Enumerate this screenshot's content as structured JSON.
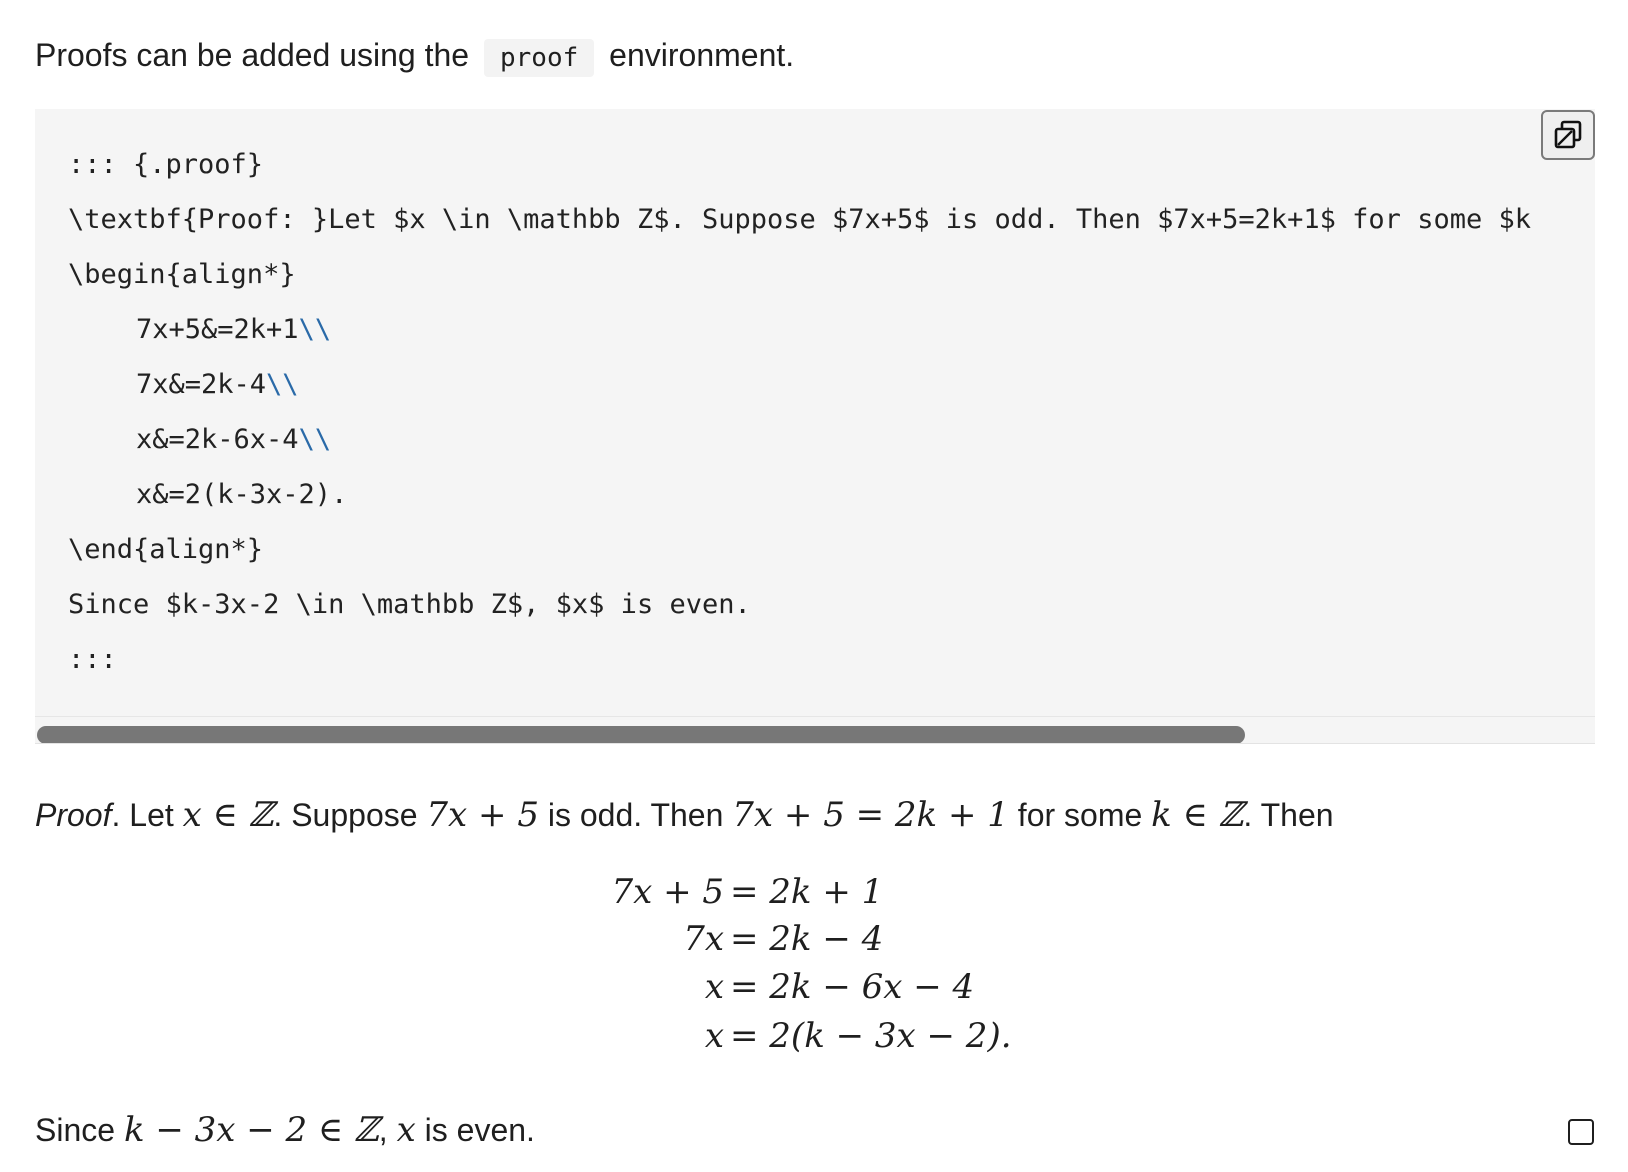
{
  "intro": {
    "before": "Proofs can be added using the",
    "code": "proof",
    "after": "environment."
  },
  "code_block": {
    "lines": [
      "::: {.proof}",
      "\\textbf{Proof: }Let $x \\in \\mathbb Z$. Suppose $7x+5$ is odd. Then $7x+5=2k+1$ for some $k",
      "\\begin{align*}",
      "7x+5&=2k+1",
      "7x&=2k-4",
      "x&=2k-6x-4",
      "x&=2(k-3x-2).",
      "\\end{align*}",
      "Since $k-3x-2 \\in \\mathbb Z$, $x$ is even.",
      ":::"
    ],
    "line_break": "\\\\",
    "copy_icon": "copy-icon"
  },
  "rendered": {
    "proof_label": "Proof",
    "p1": ". Let ",
    "m1": "x ∈ ℤ",
    "p2": ". Suppose ",
    "m2": "7x + 5",
    "p3": " is odd. Then ",
    "m3": "7x + 5 = 2k + 1",
    "p4": " for some ",
    "m4": "k ∈ ℤ",
    "p5": ". Then",
    "align": [
      {
        "lhs": "7x + 5",
        "rhs": "= 2k + 1"
      },
      {
        "lhs": "7x",
        "rhs": "= 2k − 4"
      },
      {
        "lhs": "x",
        "rhs": "= 2k − 6x − 4"
      },
      {
        "lhs": "x",
        "rhs": "= 2(k − 3x − 2)."
      }
    ],
    "since_before": "Since ",
    "since_math": "k − 3x − 2 ∈ ℤ",
    "since_comma": ", ",
    "since_x": "x",
    "since_after": " is even.",
    "qed_icon": "qed-square-icon"
  },
  "colors": {
    "code_bg": "#f5f5f5",
    "line_break": "#2a6aa8",
    "scrollbar": "#777777"
  }
}
